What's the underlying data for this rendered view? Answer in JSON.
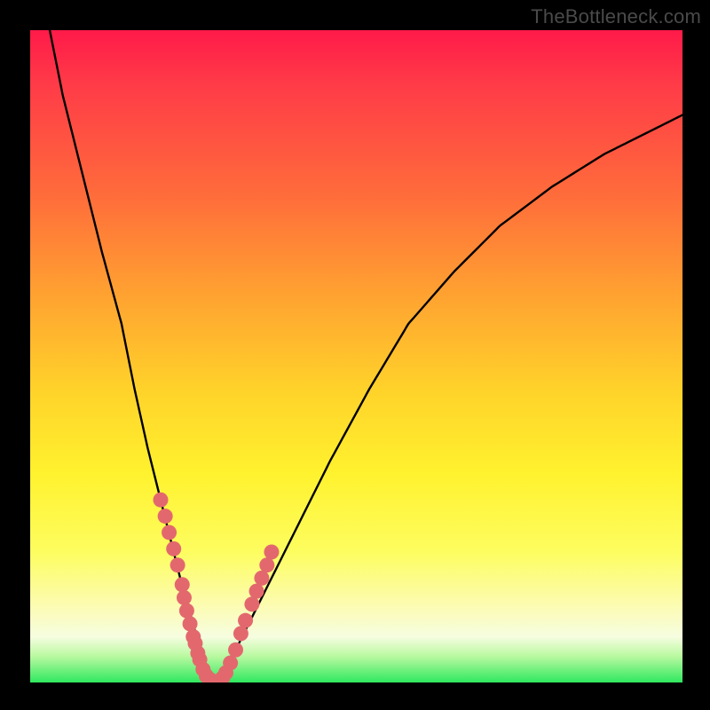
{
  "watermark": "TheBottleneck.com",
  "chart_data": {
    "type": "line",
    "title": "",
    "xlabel": "",
    "ylabel": "",
    "xlim": [
      0,
      100
    ],
    "ylim": [
      0,
      100
    ],
    "series": [
      {
        "name": "bottleneck-curve",
        "x": [
          3,
          5,
          8,
          11,
          14,
          16,
          18,
          20,
          22,
          23.5,
          25,
          26,
          27,
          28.5,
          30,
          32,
          35,
          40,
          46,
          52,
          58,
          65,
          72,
          80,
          88,
          96,
          100
        ],
        "y": [
          100,
          90,
          78,
          66,
          55,
          45,
          36,
          28,
          20,
          14,
          9,
          5,
          2,
          0,
          2,
          6,
          12,
          22,
          34,
          45,
          55,
          63,
          70,
          76,
          81,
          85,
          87
        ]
      }
    ],
    "markers": [
      {
        "name": "left-beads",
        "color": "#e3686e",
        "points": [
          {
            "x": 20.0,
            "y": 28.0
          },
          {
            "x": 20.7,
            "y": 25.5
          },
          {
            "x": 21.3,
            "y": 23.0
          },
          {
            "x": 22.0,
            "y": 20.5
          },
          {
            "x": 22.6,
            "y": 18.0
          },
          {
            "x": 23.3,
            "y": 15.0
          },
          {
            "x": 23.6,
            "y": 13.0
          },
          {
            "x": 24.0,
            "y": 11.0
          },
          {
            "x": 24.5,
            "y": 9.0
          },
          {
            "x": 25.0,
            "y": 7.0
          },
          {
            "x": 25.3,
            "y": 6.0
          },
          {
            "x": 25.7,
            "y": 4.5
          },
          {
            "x": 26.0,
            "y": 3.5
          },
          {
            "x": 26.5,
            "y": 2.0
          },
          {
            "x": 27.0,
            "y": 1.0
          },
          {
            "x": 27.5,
            "y": 0.5
          },
          {
            "x": 28.0,
            "y": 0.2
          },
          {
            "x": 28.5,
            "y": 0.0
          }
        ]
      },
      {
        "name": "right-beads",
        "color": "#e3686e",
        "points": [
          {
            "x": 29.0,
            "y": 0.2
          },
          {
            "x": 29.5,
            "y": 0.7
          },
          {
            "x": 30.0,
            "y": 1.5
          },
          {
            "x": 30.7,
            "y": 3.0
          },
          {
            "x": 31.5,
            "y": 5.0
          },
          {
            "x": 32.3,
            "y": 7.5
          },
          {
            "x": 33.0,
            "y": 9.5
          },
          {
            "x": 34.0,
            "y": 12.0
          },
          {
            "x": 34.7,
            "y": 14.0
          },
          {
            "x": 35.5,
            "y": 16.0
          },
          {
            "x": 36.3,
            "y": 18.0
          },
          {
            "x": 37.0,
            "y": 20.0
          }
        ]
      }
    ]
  }
}
